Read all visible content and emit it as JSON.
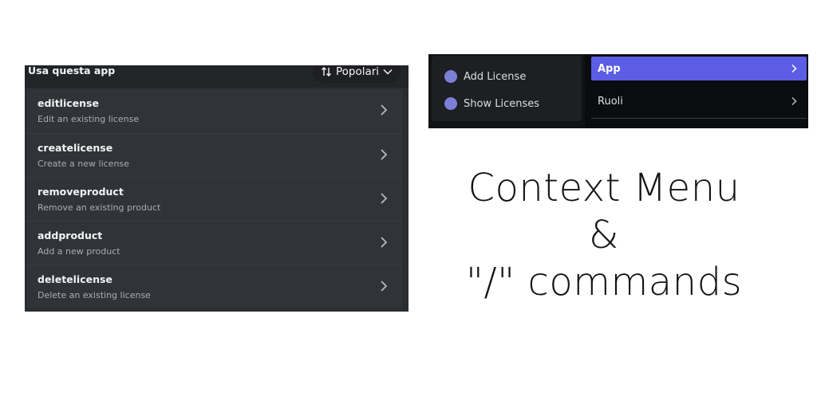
{
  "commands_panel": {
    "title": "Usa questa app",
    "sort_button": {
      "icon": "sort-arrows-icon",
      "label": "Popolari",
      "dropdown_icon": "chevron-down-icon"
    },
    "commands": [
      {
        "name": "editlicense",
        "description": "Edit an existing license"
      },
      {
        "name": "createlicense",
        "description": "Create a new license"
      },
      {
        "name": "removeproduct",
        "description": "Remove an existing product"
      },
      {
        "name": "addproduct",
        "description": "Add a new product"
      },
      {
        "name": "deletelicense",
        "description": "Delete an existing license"
      }
    ]
  },
  "context_menu": {
    "items": [
      {
        "label": "Add License",
        "icon": "app-avatar-icon"
      },
      {
        "label": "Show Licenses",
        "icon": "app-avatar-icon"
      }
    ],
    "submenu": [
      {
        "label": "App",
        "active": true
      },
      {
        "label": "Ruoli",
        "active": false
      }
    ]
  },
  "caption": {
    "line1": "Context Menu",
    "line2": "&",
    "line3": "\"/\" commands"
  },
  "colors": {
    "accent": "#5c5de5",
    "panel_bg": "#2b2d31",
    "list_bg": "#313338",
    "avatar": "#7c7fd6"
  }
}
